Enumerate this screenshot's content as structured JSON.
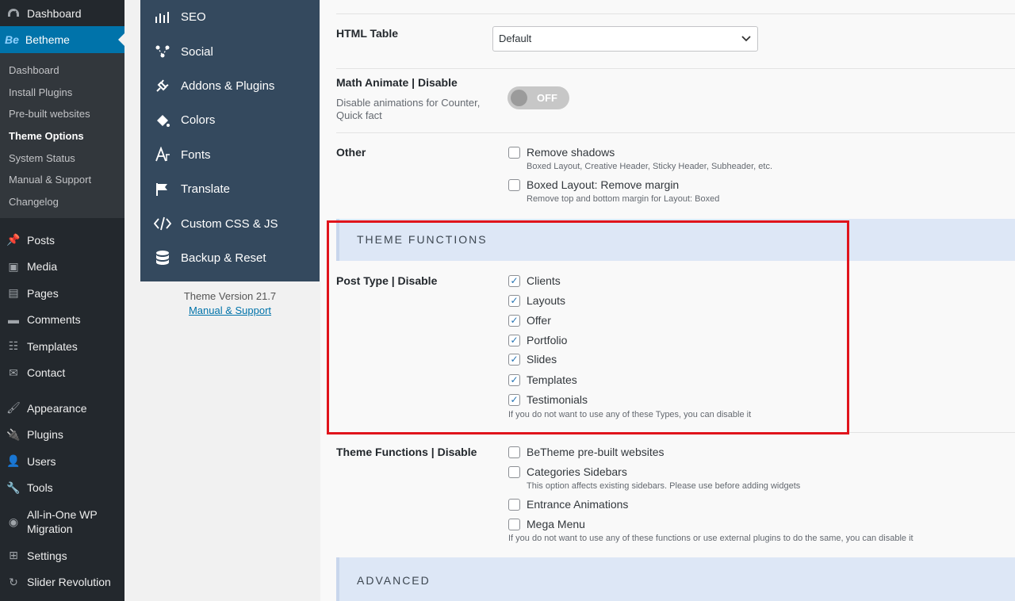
{
  "wp_sidebar": {
    "top_item": "Dashboard",
    "active_item": "Betheme",
    "active_logo": "Be",
    "submenu": [
      "Dashboard",
      "Install Plugins",
      "Pre-built websites",
      "Theme Options",
      "System Status",
      "Manual & Support",
      "Changelog"
    ],
    "items_group1": [
      "Posts",
      "Media",
      "Pages",
      "Comments",
      "Templates",
      "Contact"
    ],
    "items_group2": [
      "Appearance",
      "Plugins",
      "Users",
      "Tools",
      "All-in-One WP Migration",
      "Settings",
      "Slider Revolution"
    ]
  },
  "be_nav": {
    "items": [
      "SEO",
      "Social",
      "Addons & Plugins",
      "Colors",
      "Fonts",
      "Translate",
      "Custom CSS & JS",
      "Backup & Reset"
    ],
    "version": "Theme Version 21.7",
    "support_link": "Manual & Support"
  },
  "options": {
    "html_table": {
      "label": "HTML Table",
      "value": "Default"
    },
    "math_animate": {
      "label": "Math Animate | Disable",
      "desc": "Disable animations for Counter, Quick fact",
      "toggle": "OFF"
    },
    "other": {
      "label": "Other",
      "opt1": "Remove shadows",
      "opt1_hint": "Boxed Layout, Creative Header, Sticky Header, Subheader, etc.",
      "opt2": "Boxed Layout: Remove margin",
      "opt2_hint": "Remove top and bottom margin for Layout: Boxed"
    },
    "section_theme_functions": "THEME FUNCTIONS",
    "post_type": {
      "label": "Post Type | Disable",
      "items": [
        "Clients",
        "Layouts",
        "Offer",
        "Portfolio",
        "Slides",
        "Templates",
        "Testimonials"
      ],
      "hint": "If you do not want to use any of these Types, you can disable it"
    },
    "theme_functions": {
      "label": "Theme Functions | Disable",
      "items": [
        "BeTheme pre-built websites",
        "Categories Sidebars",
        "Entrance Animations",
        "Mega Menu"
      ],
      "categories_hint": "This option affects existing sidebars. Please use before adding widgets",
      "hint": "If you do not want to use any of these functions or use external plugins to do the same, you can disable it"
    },
    "section_advanced": "ADVANCED"
  },
  "colors": {
    "accent": "#0073aa",
    "highlight": "#e0141c",
    "nav_bg": "#34495e"
  }
}
